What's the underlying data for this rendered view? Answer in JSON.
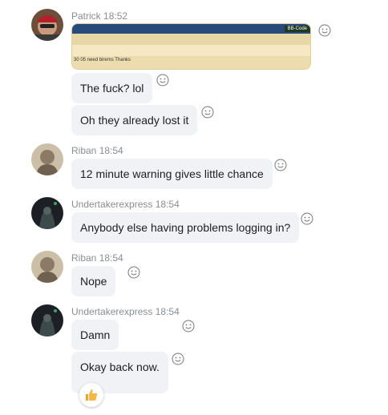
{
  "messages": [
    {
      "sender": "Patrick",
      "time": "18:52",
      "attachment_text": "30 05 need birems Thanks",
      "attachment_tag": "BB-Code",
      "texts": [
        "The fuck? lol",
        "Oh they already lost it"
      ]
    },
    {
      "sender": "Riban",
      "time": "18:54",
      "texts": [
        "12 minute warning gives little chance"
      ]
    },
    {
      "sender": "Undertakerexpress",
      "time": "18:54",
      "texts": [
        "Anybody else having problems logging in?"
      ]
    },
    {
      "sender": "Riban",
      "time": "18:54",
      "texts": [
        "Nope"
      ]
    },
    {
      "sender": "Undertakerexpress",
      "time": "18:54",
      "texts": [
        "Damn",
        "Okay back now."
      ]
    }
  ],
  "reaction_icon": "smiley-reaction-icon",
  "thumbs_up_icon": "thumbs-up-icon"
}
